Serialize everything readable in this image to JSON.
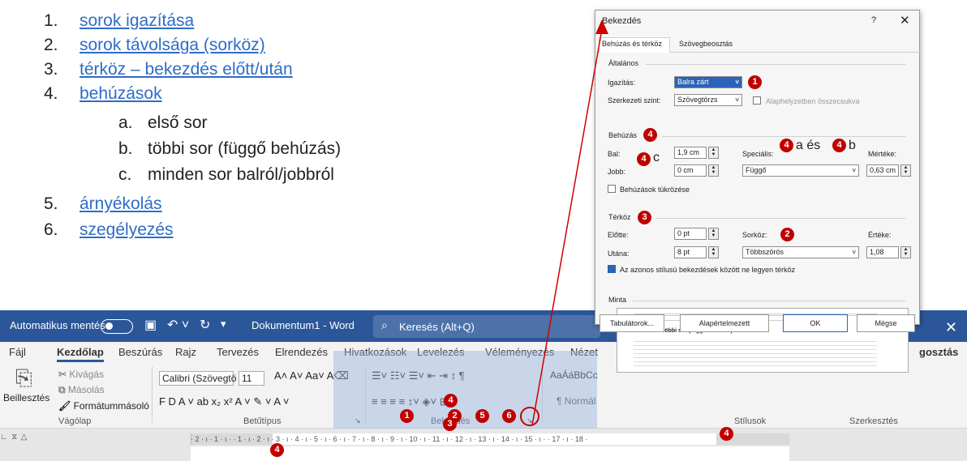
{
  "list": {
    "items": [
      {
        "num": "1.",
        "text": "sorok igazítása"
      },
      {
        "num": "2.",
        "text": "sorok távolsága (sorköz)"
      },
      {
        "num": "3.",
        "text": "térköz – bekezdés előtt/után"
      },
      {
        "num": "4.",
        "text": "behúzások"
      },
      {
        "num": "5.",
        "text": "árnyékolás"
      },
      {
        "num": "6.",
        "text": "szegélyezés"
      }
    ],
    "subitems": [
      {
        "num": "a.",
        "text": "első sor"
      },
      {
        "num": "b.",
        "text": "többi sor (függő behúzás)"
      },
      {
        "num": "c.",
        "text": "minden sor balról/jobbról"
      }
    ]
  },
  "titlebar": {
    "autosave": "Automatikus mentés",
    "doc_title": "Dokumentum1 - Word",
    "search_placeholder": "Keresés (Alt+Q)"
  },
  "ribbon_tabs": [
    "Fájl",
    "Kezdőlap",
    "Beszúrás",
    "Rajz",
    "Tervezés",
    "Elrendezés",
    "Hivatkozások",
    "Levelezés",
    "Véleményezés",
    "Nézet"
  ],
  "share_label": "gosztás",
  "ribbon": {
    "paste": "Beillesztés",
    "cut": "Kivágás",
    "copy": "Másolás",
    "format_painter": "Formátummásoló",
    "clipboard_group": "Vágólap",
    "font_name": "Calibri (Szövegtö",
    "font_size": "11",
    "font_group": "Betűtípus",
    "paragraph_group": "Bekezdés",
    "styles_sample": "AaÁáBbCc",
    "normal_style": "¶ Normál",
    "styles_group": "Stílusok",
    "editing_group": "Szerkesztés"
  },
  "ruler_text": "· 2 · ı · 1 · ı ·   · 1 · ı · 2 · ı · 3 · ı · 4 · ı · 5 · ı · 6 · ı · 7 · ı · 8 · ı · 9 · ı · 10 · ı · 11 · ı · 12 · ı · 13 · ı · 14 · ı · 15 · ı ·   · 17 · ı · 18 ·",
  "dialog": {
    "title": "Bekezdés",
    "help": "?",
    "close": "✕",
    "tab1": "Behúzás és térköz",
    "tab2": "Szövegbeosztás",
    "general": "Általános",
    "alignment_label": "Igazítás:",
    "alignment_value": "Balra zárt",
    "outline_label": "Szerkezeti szint:",
    "outline_value": "Szövegtörzs",
    "collapsed_label": "Alaphelyzetben összecsukva",
    "indent_section": "Behúzás",
    "left_label": "Bal:",
    "left_value": "1,9 cm",
    "right_label": "Jobb:",
    "right_value": "0 cm",
    "special_label": "Speciális:",
    "special_value": "Függő",
    "special_annot_mid": "a és",
    "special_annot_end": "b",
    "by_label": "Mértéke:",
    "by_value": "0,63 cm",
    "mirror_label": "Behúzások tükrözése",
    "spacing_section": "Térköz",
    "before_label": "Előtte:",
    "before_value": "0 pt",
    "after_label": "Utána:",
    "after_value": "8 pt",
    "line_label": "Sorköz:",
    "line_value": "Többszörös",
    "at_label": "Értéke:",
    "at_value": "1,08",
    "same_style_label": "Az azonos stílusú bekezdések között ne legyen térköz",
    "preview_section": "Minta",
    "preview_caption": "többi sor (függő behúzás)",
    "tabs_button": "Tabulátorok...",
    "default_button": "Alapértelmezett",
    "ok_button": "OK",
    "cancel_button": "Mégse"
  },
  "markers": {
    "align": "1",
    "line": "2",
    "spacing": "3",
    "indent": "4",
    "shading": "5",
    "border": "6",
    "c_letter": "c"
  },
  "colors": {
    "accent": "#2b579a",
    "marker": "#c00000",
    "link": "#2e6cc6",
    "highlight": "#96b4e1"
  }
}
